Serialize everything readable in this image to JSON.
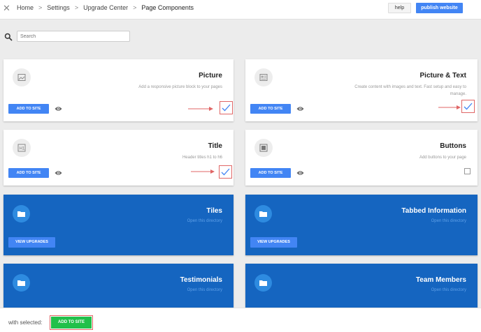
{
  "header": {
    "close_label": "✕",
    "breadcrumbs": [
      "Home",
      "Settings",
      "Upgrade Center",
      "Page Components"
    ],
    "separator": ">",
    "help_label": "help",
    "publish_label": "publish website"
  },
  "search": {
    "placeholder": "Search"
  },
  "components": [
    {
      "title": "Picture",
      "description": "Add a responsive picture block to your pages",
      "add_label": "ADD TO SITE",
      "checked": true,
      "icon": "image-icon"
    },
    {
      "title": "Picture & Text",
      "description": "Create content with images and text. Fast setup and easy to manage.",
      "add_label": "ADD TO SITE",
      "checked": true,
      "icon": "image-text-icon"
    },
    {
      "title": "Title",
      "description": "Header titles h1 to h6",
      "add_label": "ADD TO SITE",
      "checked": true,
      "icon": "heading-icon"
    },
    {
      "title": "Buttons",
      "description": "Add buttons to your page",
      "add_label": "ADD TO SITE",
      "checked": false,
      "icon": "button-icon"
    }
  ],
  "directories": [
    {
      "title": "Tiles",
      "subtitle": "Open this directory",
      "view_label": "VIEW UPGRADES",
      "icon": "folder-icon"
    },
    {
      "title": "Tabbed Information",
      "subtitle": "Open this directory",
      "view_label": "VIEW UPGRADES",
      "icon": "folder-icon"
    },
    {
      "title": "Testimonials",
      "subtitle": "Open this directory",
      "icon": "folder-icon"
    },
    {
      "title": "Team Members",
      "subtitle": "Open this directory",
      "icon": "folder-icon"
    }
  ],
  "bottom": {
    "with_selected_label": "with selected:",
    "add_label": "ADD TO SITE"
  },
  "colors": {
    "primary": "#4285f4",
    "directory_bg": "#1565c0",
    "highlight": "#e06666",
    "success": "#21c04a"
  }
}
